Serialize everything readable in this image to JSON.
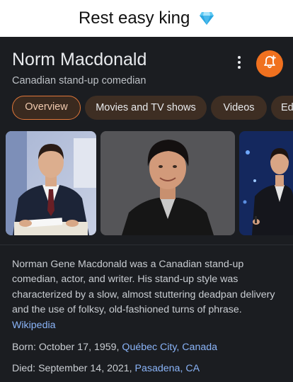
{
  "caption": {
    "text": "Rest easy king"
  },
  "panel": {
    "title": "Norm Macdonald",
    "subtitle": "Canadian stand-up comedian",
    "accent_color": "#f0711f"
  },
  "tabs": [
    {
      "label": "Overview",
      "active": true
    },
    {
      "label": "Movies and TV shows",
      "active": false
    },
    {
      "label": "Videos",
      "active": false
    },
    {
      "label": "Ed",
      "active": false
    }
  ],
  "description": {
    "text": "Norman Gene Macdonald was a Canadian stand-up comedian, actor, and writer. His stand-up style was characterized by a slow, almost stuttering deadpan delivery and the use of folksy, old-fashioned turns of phrase.",
    "source": "Wikipedia"
  },
  "facts": {
    "born": {
      "label": "Born:",
      "date": "October 17, 1959,",
      "place": "Québec City, Canada"
    },
    "died": {
      "label": "Died:",
      "date": "September 14, 2021,",
      "place": "Pasadena, CA"
    }
  }
}
